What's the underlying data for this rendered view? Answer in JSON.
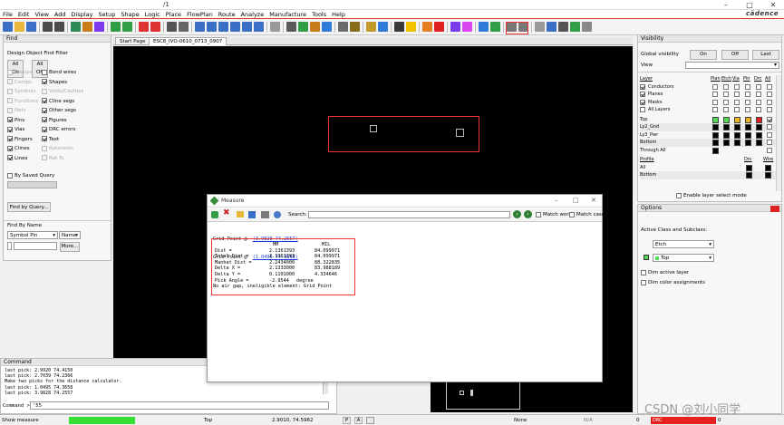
{
  "window": {
    "title": "/1",
    "min": "–",
    "max": "□",
    "close": "✕"
  },
  "brand": "cādence",
  "menu": [
    "File",
    "Edit",
    "View",
    "Add",
    "Display",
    "Setup",
    "Shape",
    "Logic",
    "Place",
    "FlowPlan",
    "Route",
    "Analyze",
    "Manufacture",
    "Tools",
    "Help"
  ],
  "find": {
    "title": "Find",
    "filter_title": "Design Object Find Filter",
    "all_on": "All On",
    "all_off": "All Off",
    "left_items": [
      {
        "label": "Groups",
        "checked": false,
        "enabled": false
      },
      {
        "label": "Comps",
        "checked": false,
        "enabled": false
      },
      {
        "label": "Symbols",
        "checked": false,
        "enabled": false
      },
      {
        "label": "Functions",
        "checked": false,
        "enabled": false
      },
      {
        "label": "Nets",
        "checked": false,
        "enabled": false
      },
      {
        "label": "Pins",
        "checked": true,
        "enabled": true
      },
      {
        "label": "Vias",
        "checked": true,
        "enabled": true
      },
      {
        "label": "Fingers",
        "checked": true,
        "enabled": true
      },
      {
        "label": "Clines",
        "checked": true,
        "enabled": true
      },
      {
        "label": "Lines",
        "checked": true,
        "enabled": true
      }
    ],
    "right_items": [
      {
        "label": "Bond wires",
        "checked": false,
        "enabled": true
      },
      {
        "label": "Shapes",
        "checked": true,
        "enabled": true
      },
      {
        "label": "Voids/Cavities",
        "checked": false,
        "enabled": false
      },
      {
        "label": "Cline segs",
        "checked": true,
        "enabled": true
      },
      {
        "label": "Other segs",
        "checked": true,
        "enabled": true
      },
      {
        "label": "Figures",
        "checked": true,
        "enabled": true
      },
      {
        "label": "DRC errors",
        "checked": true,
        "enabled": true
      },
      {
        "label": "Text",
        "checked": true,
        "enabled": true
      },
      {
        "label": "Ratsnests",
        "checked": false,
        "enabled": false
      },
      {
        "label": "Rat Ts",
        "checked": false,
        "enabled": false
      }
    ],
    "by_saved_query": "By Saved Query",
    "find_by_query": "Find by Query...",
    "find_by_name": "Find By Name",
    "type_select": "Symbol Pin",
    "name_select": "Name",
    "more": "More..."
  },
  "tabs": [
    "Start Page",
    "ESC8_IVO-0610_0713_0907"
  ],
  "command": {
    "title": "Command",
    "lines": [
      "last pick:  2.9920 74.4150",
      "last pick:  2.7039 74.2366",
      "Make two picks for the distance calculator.",
      "last pick:  1.0495 74.3658",
      "last pick:  3.9828 74.2557"
    ],
    "prompt": "Command >",
    "value": "'55"
  },
  "visibility": {
    "title": "Visibility",
    "global_label": "Global visibility",
    "on": "On",
    "off": "Off",
    "last": "Last",
    "view_label": "View",
    "cols": [
      "Plan",
      "Etch",
      "Via",
      "Pin",
      "Drc",
      "All"
    ],
    "layer_head": "Layer",
    "layers": [
      {
        "name": "Conductors",
        "checked": true
      },
      {
        "name": "Planes",
        "checked": true
      },
      {
        "name": "Masks",
        "checked": true
      },
      {
        "name": "All Layers",
        "checked": false
      }
    ],
    "rows": [
      {
        "name": "Top",
        "colors": [
          "#55d955",
          "#55d955",
          "#e6b422",
          "#e6b422",
          "#e02020"
        ],
        "all": true
      },
      {
        "name": "Ly2_Gnd",
        "colors": [
          "#000",
          "#000",
          "#000",
          "#000",
          "#000"
        ],
        "all": false
      },
      {
        "name": "Ly3_Pwr",
        "colors": [
          "#000",
          "#000",
          "#000",
          "#000",
          "#000"
        ],
        "all": false
      },
      {
        "name": "Bottom",
        "colors": [
          "#000",
          "#000",
          "#000",
          "#000",
          "#000"
        ],
        "all": false
      },
      {
        "name": "Through All",
        "colors": [
          "#000",
          "",
          "",
          "",
          ""
        ],
        "all": false
      }
    ],
    "profile_head": "Profile",
    "profile_cols": [
      "Drc",
      "Wire"
    ],
    "profile_rows": [
      {
        "name": "All"
      },
      {
        "name": "Bottom"
      }
    ],
    "enable_layer_select": "Enable layer select mode"
  },
  "options": {
    "title": "Options",
    "active_class": "Active Class and Subclass:",
    "class_value": "Etch",
    "subclass_value": "Top",
    "dim_active": "Dim active layer",
    "dim_color": "Dim color assignments"
  },
  "measure": {
    "title": "Measure",
    "search_label": "Search:",
    "match_word": "Match word",
    "match_case": "Match case",
    "grid1_label": "Grid Point @",
    "grid1_link": "(3.9828 74.2557)",
    "grid2_label": "Grid Point @",
    "grid2_link": "(1.0495 74.3658)",
    "col_mm": "MM",
    "col_mil": "MIL",
    "rows": [
      {
        "label": "Dist =",
        "mm": "2.1361393",
        "mil": "84.099971"
      },
      {
        "label": "Total Dist =",
        "mm": "2.1361393",
        "mil": "84.099971"
      },
      {
        "label": "Manhat Dist =",
        "mm": "2.2434000",
        "mil": "88.322835"
      },
      {
        "label": "Delta X =",
        "mm": "2.1333000",
        "mil": "83.988189"
      },
      {
        "label": "Delta Y =",
        "mm": "0.1101000",
        "mil": "4.334646"
      }
    ],
    "pick_angle_label": "Pick Angle =",
    "pick_angle_value": "-2.9544",
    "pick_angle_unit": "degree",
    "note": "No air gap, ineligible element: Grid Point"
  },
  "status": {
    "mode": "Show measure",
    "layer": "Top",
    "coords": "2.9010, 74.5962",
    "p_btn": "P",
    "a_btn": "A",
    "none": "None",
    "na": "N/A",
    "drc": "DRC",
    "drc_count": "0",
    "zero_left": "0",
    "watermark": "CSDN @刘小同学"
  }
}
